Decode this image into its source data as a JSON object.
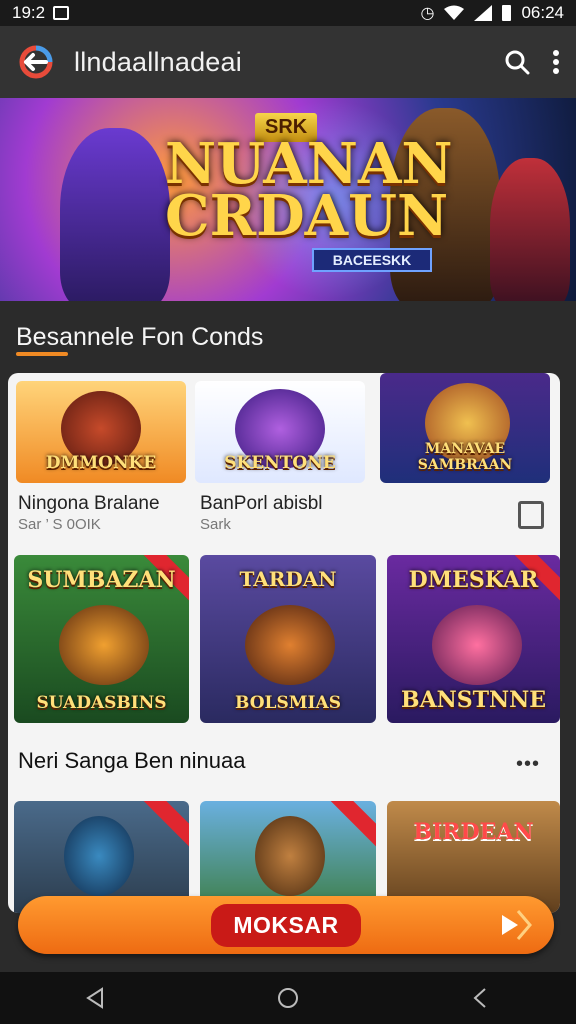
{
  "status_bar": {
    "time_left": "19:2",
    "time_right": "06:24"
  },
  "app_bar": {
    "title": "llndaallnadeai"
  },
  "hero": {
    "small_label": "SRK",
    "title_line1": "NUANAN",
    "title_line2": "CRDAUN",
    "tag": "BACEESKK"
  },
  "section1": {
    "title": "Besannele Fon Conds"
  },
  "top_cards": [
    {
      "caption": "DMMONKE"
    },
    {
      "caption": "SKENTONE"
    },
    {
      "caption": "MANAVAE SAMBRAAN"
    }
  ],
  "games": [
    {
      "name": "Ningona Bralane",
      "meta": "Sar ’ S 0OIK"
    },
    {
      "name": "BanPorl abisbl",
      "meta": "Sark"
    }
  ],
  "grid_cards": [
    {
      "caption_top": "SUMBAZAN",
      "caption_bottom": "SUADASBINS"
    },
    {
      "caption_top": "TARDAN",
      "caption_bottom": "BOLSMIAS"
    },
    {
      "caption_top": "DMESKAR",
      "caption_bottom": "BANSTNNE"
    }
  ],
  "section2": {
    "title": "Neri Sanga Ben ninuaa",
    "more": "•••"
  },
  "bottom_cards": [
    {
      "caption": ""
    },
    {
      "caption": ""
    },
    {
      "caption": "BIRDEAN"
    }
  ],
  "cta": {
    "label": "MOKSAR"
  },
  "colors": {
    "accent": "#f08a24",
    "cta": "#ee6b12",
    "pill": "#c91a17",
    "ribbon": "#e0262f"
  }
}
